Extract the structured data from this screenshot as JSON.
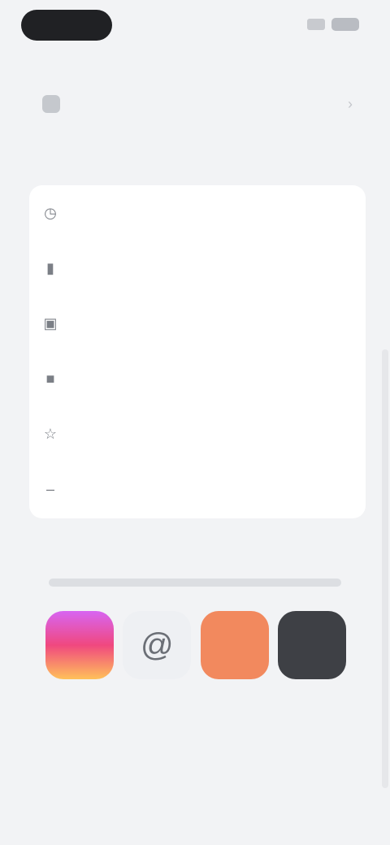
{
  "status": {
    "pill_text": ""
  },
  "app": {
    "title": ""
  },
  "top_item": {
    "label": ""
  },
  "section": {
    "title": ""
  },
  "menu": {
    "items": [
      {
        "icon": "clock-icon",
        "label": ""
      },
      {
        "icon": "bookmark-icon",
        "label": ""
      },
      {
        "icon": "archive-icon",
        "label": ""
      },
      {
        "icon": "square-icon",
        "label": ""
      },
      {
        "icon": "star-icon",
        "label": ""
      },
      {
        "icon": "dash-icon",
        "label": ""
      }
    ]
  },
  "apps": {
    "heading": "",
    "tiles": [
      {
        "name": "instagram",
        "label": ""
      },
      {
        "name": "threads",
        "label": "@"
      },
      {
        "name": "orange-app",
        "label": ""
      },
      {
        "name": "dark-app",
        "label": ""
      }
    ]
  },
  "footer": {
    "line1": "",
    "line2": ""
  },
  "colors": {
    "card": "#ffffff",
    "background": "#f2f3f5"
  }
}
